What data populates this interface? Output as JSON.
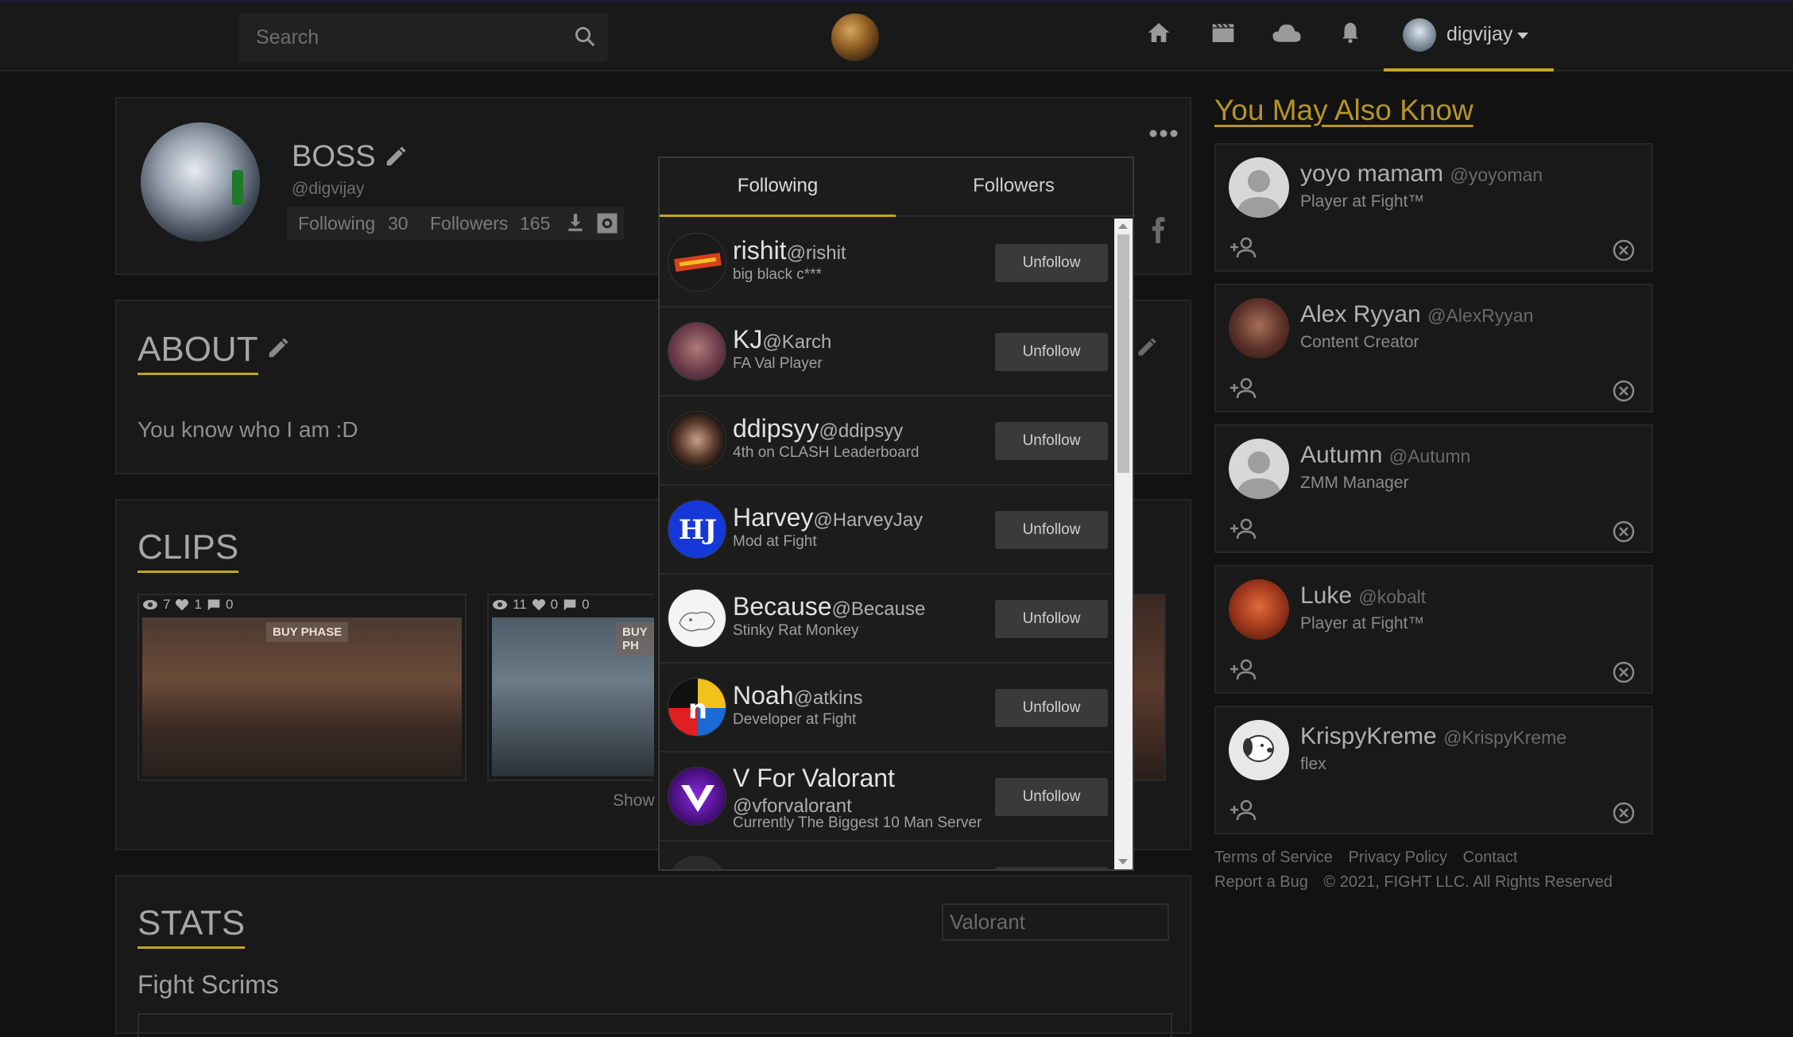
{
  "nav": {
    "search_placeholder": "Search",
    "username": "digvijay"
  },
  "profile": {
    "name": "BOSS",
    "handle": "@digvijay",
    "following_label": "Following",
    "following_count": "30",
    "followers_label": "Followers",
    "followers_count": "165"
  },
  "about": {
    "title": "ABOUT",
    "text": "You know who I am :D"
  },
  "clips": {
    "title": "CLIPS",
    "items": [
      {
        "views": "7",
        "likes": "1",
        "comments": "0",
        "banner": "BUY PHASE"
      },
      {
        "views": "11",
        "likes": "0",
        "comments": "0",
        "banner": "BUY PH"
      }
    ],
    "show_label": "Show"
  },
  "stats": {
    "title": "STATS",
    "game_select": "Valorant",
    "subtitle": "Fight Scrims"
  },
  "modal": {
    "tabs": [
      "Following",
      "Followers"
    ],
    "rows": [
      {
        "name": "rishit",
        "handle": "@rishit",
        "desc": "big black c***",
        "button": "Unfollow"
      },
      {
        "name": "KJ",
        "handle": "@Karch",
        "desc": "FA Val Player",
        "button": "Unfollow"
      },
      {
        "name": "ddipsyy",
        "handle": "@ddipsyy",
        "desc": "4th on CLASH Leaderboard",
        "button": "Unfollow"
      },
      {
        "name": "Harvey",
        "handle": "@HarveyJay",
        "desc": "Mod at Fight",
        "button": "Unfollow"
      },
      {
        "name": "Because",
        "handle": "@Because",
        "desc": "Stinky Rat Monkey",
        "button": "Unfollow"
      },
      {
        "name": "Noah",
        "handle": "@atkins",
        "desc": "Developer at Fight",
        "button": "Unfollow"
      },
      {
        "name": "V For Valorant",
        "handle": "@vforvalorant",
        "desc": "Currently The Biggest 10 Man Server",
        "button": "Unfollow"
      }
    ]
  },
  "sidebar": {
    "title": "You May Also Know",
    "suggestions": [
      {
        "name": "yoyo mamam",
        "handle": "@yoyoman",
        "desc": "Player at Fight™"
      },
      {
        "name": "Alex Ryyan",
        "handle": "@AlexRyyan",
        "desc": "Content Creator"
      },
      {
        "name": "Autumn",
        "handle": "@Autumn",
        "desc": "ZMM Manager"
      },
      {
        "name": "Luke",
        "handle": "@kobalt",
        "desc": "Player at Fight™"
      },
      {
        "name": "KrispyKreme",
        "handle": "@KrispyKreme",
        "desc": "flex"
      }
    ]
  },
  "footer": {
    "links": [
      "Terms of Service",
      "Privacy Policy",
      "Contact",
      "Report a Bug"
    ],
    "copyright": "© 2021, FIGHT LLC. All Rights Reserved"
  },
  "colors": {
    "accent": "#c7a41e",
    "background": "#121212",
    "card": "#191919"
  }
}
